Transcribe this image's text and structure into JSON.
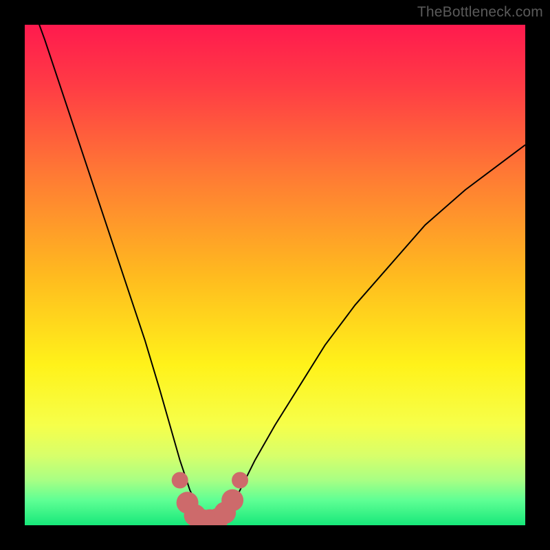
{
  "watermark": "TheBottleneck.com",
  "colors": {
    "frame": "#000000",
    "curve": "#000000",
    "marker": "#cd6a6b",
    "gradient_stops": [
      {
        "offset": 0.0,
        "color": "#ff1a4e"
      },
      {
        "offset": 0.12,
        "color": "#ff3b45"
      },
      {
        "offset": 0.3,
        "color": "#ff7a34"
      },
      {
        "offset": 0.5,
        "color": "#ffba1f"
      },
      {
        "offset": 0.68,
        "color": "#fff21a"
      },
      {
        "offset": 0.8,
        "color": "#f6ff4a"
      },
      {
        "offset": 0.86,
        "color": "#d8ff6a"
      },
      {
        "offset": 0.91,
        "color": "#a8ff84"
      },
      {
        "offset": 0.95,
        "color": "#5fff94"
      },
      {
        "offset": 1.0,
        "color": "#17e87a"
      }
    ]
  },
  "chart_data": {
    "type": "line",
    "title": "",
    "xlabel": "",
    "ylabel": "",
    "xlim": [
      0,
      100
    ],
    "ylim": [
      0,
      100
    ],
    "grid": false,
    "series": [
      {
        "name": "bottleneck-curve",
        "x": [
          0,
          4,
          8,
          12,
          16,
          20,
          24,
          27,
          29,
          31,
          33,
          35,
          37,
          39,
          41,
          43,
          46,
          50,
          55,
          60,
          66,
          73,
          80,
          88,
          96,
          100
        ],
        "y": [
          108,
          97,
          85,
          73,
          61,
          49,
          37,
          27,
          20,
          13,
          7,
          3,
          1,
          1,
          3,
          7,
          13,
          20,
          28,
          36,
          44,
          52,
          60,
          67,
          73,
          76
        ]
      }
    ],
    "markers": {
      "name": "highlighted-minimum",
      "x": [
        31.0,
        32.5,
        34.0,
        35.5,
        37.0,
        38.5,
        40.0,
        41.5,
        43.0
      ],
      "y": [
        9.0,
        4.5,
        2.0,
        1.0,
        1.0,
        1.2,
        2.5,
        5.0,
        9.0
      ],
      "size": [
        12,
        16,
        16,
        16,
        16,
        16,
        16,
        16,
        12
      ]
    },
    "annotations": []
  }
}
